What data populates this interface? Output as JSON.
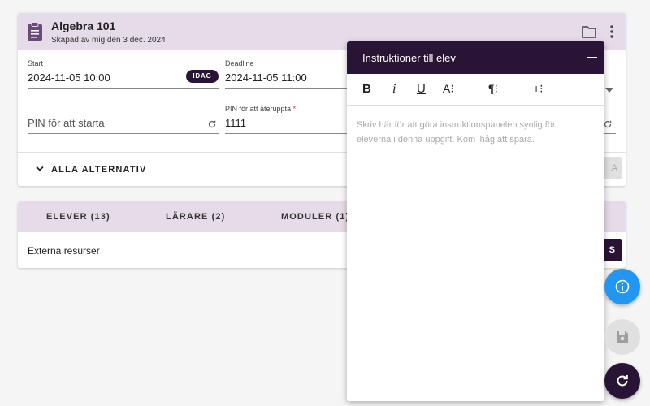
{
  "assignment": {
    "title": "Algebra 101",
    "subtitle": "Skapad av mig den 3 dec. 2024"
  },
  "fields": {
    "start_label": "Start",
    "start_value": "2024-11-05 10:00",
    "today_chip": "IDAG",
    "deadline_label": "Deadline",
    "deadline_value": "2024-11-05 11:00",
    "pin_start_placeholder": "PIN för att starta",
    "pin_resume_label": "PIN för att återuppta",
    "pin_resume_required_mark": "*",
    "pin_resume_value": "1111"
  },
  "options": {
    "all_options_label": "ALLA ALTERNATIV",
    "disabled_button_partial": "A"
  },
  "tabs": [
    {
      "label": "ELEVER (13)"
    },
    {
      "label": "LÄRARE (2)"
    },
    {
      "label": "MODULER (1)"
    }
  ],
  "resources": {
    "label": "Externa resurser",
    "button_partial": "S"
  },
  "instructions_panel": {
    "title": "Instruktioner till elev",
    "toolbar": [
      "B",
      "i",
      "U",
      "A⁝",
      "¶⁝",
      "+⁝"
    ],
    "editor_placeholder": "Skriv här för att göra instruktionspanelen synlig för eleverna i denna uppgift. Kom ihåg att spara."
  },
  "colors": {
    "primary_dark": "#2a1436",
    "header_bg": "#e6dbe8",
    "info_fab": "#2196f3"
  },
  "icons": [
    "clipboard-icon",
    "folder-icon",
    "more-vert-icon",
    "refresh-icon",
    "chevron-down-icon",
    "info-icon",
    "save-icon"
  ]
}
